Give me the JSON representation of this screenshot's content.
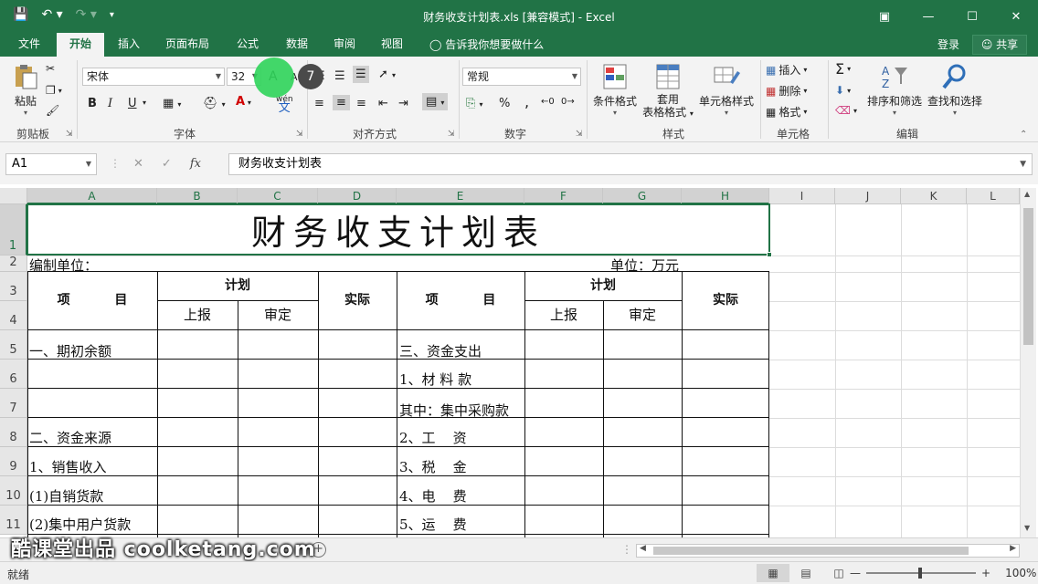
{
  "window": {
    "title": "财务收支计划表.xls  [兼容模式] - Excel",
    "controls": [
      "restore-ribbon",
      "minimize",
      "maximize",
      "close"
    ]
  },
  "qat": {
    "save": "save-icon",
    "undo": "undo-icon",
    "redo": "redo-icon",
    "customize": "customize-icon"
  },
  "tabs": [
    {
      "label": "文件"
    },
    {
      "label": "开始"
    },
    {
      "label": "插入"
    },
    {
      "label": "页面布局"
    },
    {
      "label": "公式"
    },
    {
      "label": "数据"
    },
    {
      "label": "审阅"
    },
    {
      "label": "视图"
    }
  ],
  "tell_me": "告诉我你想要做什么",
  "login": "登录",
  "share": "共享",
  "clipboard": {
    "paste": "粘贴",
    "label": "剪贴板"
  },
  "font": {
    "name": "宋体",
    "size": "32",
    "grow": "A",
    "shrink": "A",
    "label": "字体",
    "bold": "B",
    "italic": "I",
    "underline": "U",
    "phonetic": "wén"
  },
  "alignment": {
    "label": "对齐方式"
  },
  "number": {
    "format": "常规",
    "percent": "%",
    "comma": ",",
    "label": "数字"
  },
  "styles": {
    "conditional": "条件格式",
    "table1": "套用",
    "table2": "表格格式",
    "cell_styles": "单元格样式",
    "label": "样式"
  },
  "cells": {
    "insert": "插入",
    "delete": "删除",
    "format": "格式",
    "label": "单元格"
  },
  "editing": {
    "sort": "排序和筛选",
    "find": "查找和选择",
    "label": "编辑"
  },
  "click_step": "7",
  "formula_bar": {
    "cell_ref": "A1",
    "fx": "fx",
    "content": "财务收支计划表"
  },
  "columns": [
    "A",
    "B",
    "C",
    "D",
    "E",
    "F",
    "G",
    "H",
    "I",
    "J",
    "K",
    "L"
  ],
  "rows": [
    "1",
    "2",
    "3",
    "4",
    "5",
    "6",
    "7",
    "8",
    "9",
    "10",
    "11"
  ],
  "sheet": {
    "title": "财务收支计划表",
    "unit_left": "编制单位：",
    "unit_right": "单位：万元",
    "h_item": "项          目",
    "h_plan": "计划",
    "h_report": "上报",
    "h_approve": "审定",
    "h_actual": "实际",
    "left_items": [
      "一、期初余额",
      "",
      "",
      "二、资金来源",
      "1、销售收入",
      "(1)自销货款",
      "(2)集中用户货款"
    ],
    "right_items": [
      "三、资金支出",
      "1、材 料 款",
      "其中：集中采购款",
      "2、工    资",
      "3、税    金",
      "4、电    费",
      "5、运    费"
    ]
  },
  "watermark": "酷课堂出品 coolketang.com",
  "status": {
    "ready": "就绪",
    "zoom": "100%"
  }
}
